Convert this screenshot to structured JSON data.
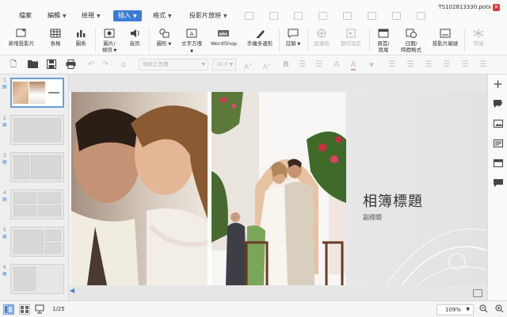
{
  "menubar": {
    "tabs": [
      {
        "label": "檔案"
      },
      {
        "label": "編輯"
      },
      {
        "label": "檢視"
      },
      {
        "label": "插入"
      },
      {
        "label": "格式"
      },
      {
        "label": "投影片放映"
      }
    ],
    "active_tab": "插入",
    "filename": "TS102813330.potx",
    "close_icon": "close-icon",
    "accent": "#3a7bd5"
  },
  "ribbon": {
    "items": [
      {
        "label": "新增投影片",
        "icon": "new-slide-icon",
        "enabled": true
      },
      {
        "label": "表格",
        "icon": "table-icon",
        "enabled": true
      },
      {
        "label": "圖表",
        "icon": "chart-icon",
        "enabled": true
      },
      {
        "label": "圖片/",
        "label2": "視訊",
        "icon": "picture-icon",
        "enabled": true
      },
      {
        "label": "音訊",
        "icon": "audio-icon",
        "enabled": true
      },
      {
        "label": "圖形",
        "icon": "shapes-icon",
        "enabled": true
      },
      {
        "label": "文字方塊",
        "icon": "textbox-icon",
        "enabled": true
      },
      {
        "label": "WordShop",
        "icon": "wordart-icon",
        "enabled": true
      },
      {
        "label": "手繪多邊形",
        "icon": "freeform-icon",
        "enabled": true
      },
      {
        "label": "註解",
        "icon": "comment-icon",
        "enabled": true
      },
      {
        "label": "超連結",
        "icon": "hyperlink-icon",
        "enabled": false
      },
      {
        "label": "動作設定",
        "icon": "action-icon",
        "enabled": false
      },
      {
        "label": "頁首/",
        "label2": "頁尾",
        "icon": "header-footer-icon",
        "enabled": true
      },
      {
        "label": "日期/",
        "label2": "時間格式",
        "icon": "datetime-icon",
        "enabled": true
      },
      {
        "label": "投影片編號",
        "icon": "slide-number-icon",
        "enabled": true
      },
      {
        "label": "符號",
        "icon": "symbol-icon",
        "enabled": false
      }
    ]
  },
  "format_toolbar": {
    "font_name": "微軟正黑體",
    "font_size": "36.0",
    "buttons": [
      "new-file-icon",
      "open-folder-icon",
      "save-icon",
      "print-icon",
      "undo-icon",
      "redo-icon",
      "format-painter-icon",
      "increase-font-icon",
      "decrease-font-icon",
      "bold-icon",
      "italic-icon",
      "underline-icon",
      "strikethrough-icon",
      "shadow-icon",
      "font-color-icon"
    ]
  },
  "slide_panel": {
    "thumbnails": [
      {
        "number": "1",
        "selected": true
      },
      {
        "number": "2",
        "selected": false
      },
      {
        "number": "3",
        "selected": false
      },
      {
        "number": "4",
        "selected": false
      },
      {
        "number": "5",
        "selected": false
      },
      {
        "number": "6",
        "selected": false
      }
    ]
  },
  "slide": {
    "title": "相簿標題",
    "subtitle": "副標題"
  },
  "right_panel": {
    "tools": [
      "add-icon",
      "edit-shape-icon",
      "image-icon",
      "textbox-tool-icon",
      "table-tool-icon",
      "comment-tool-icon"
    ]
  },
  "statusbar": {
    "page_indicator": "1/25",
    "zoom": "109%",
    "views": [
      "normal-view-icon",
      "slide-sorter-icon",
      "slideshow-icon"
    ]
  }
}
